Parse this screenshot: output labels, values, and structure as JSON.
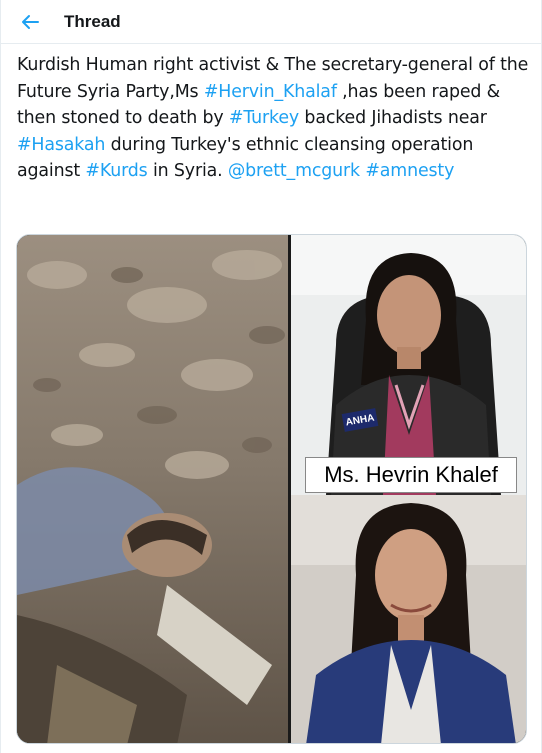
{
  "header": {
    "back_icon": "arrow-left-icon",
    "title": "Thread"
  },
  "tweet": {
    "segments": [
      {
        "text": "Kurdish Human right activist & The secretary-general of the Future Syria Party,Ms ",
        "type": "text"
      },
      {
        "text": "#Hervin_Khalaf",
        "type": "hashtag"
      },
      {
        "text": " ,has been raped & then stoned to death by ",
        "type": "text"
      },
      {
        "text": "#Turkey",
        "type": "hashtag"
      },
      {
        "text": " backed Jihadists near ",
        "type": "text"
      },
      {
        "text": "#Hasakah",
        "type": "hashtag"
      },
      {
        "text": " during Turkey's ethnic cleansing operation against ",
        "type": "text"
      },
      {
        "text": "#Kurds",
        "type": "hashtag"
      },
      {
        "text": " in Syria. ",
        "type": "text"
      },
      {
        "text": "@brett_mcgurk",
        "type": "mention"
      },
      {
        "text": " ",
        "type": "text"
      },
      {
        "text": "#amnesty",
        "type": "hashtag"
      }
    ]
  },
  "media": {
    "caption": "Ms. Hevrin Khalef",
    "mic_badge": "ANHA"
  },
  "colors": {
    "link": "#1da1f2",
    "text": "#14171a",
    "border": "#e6ecf0"
  }
}
